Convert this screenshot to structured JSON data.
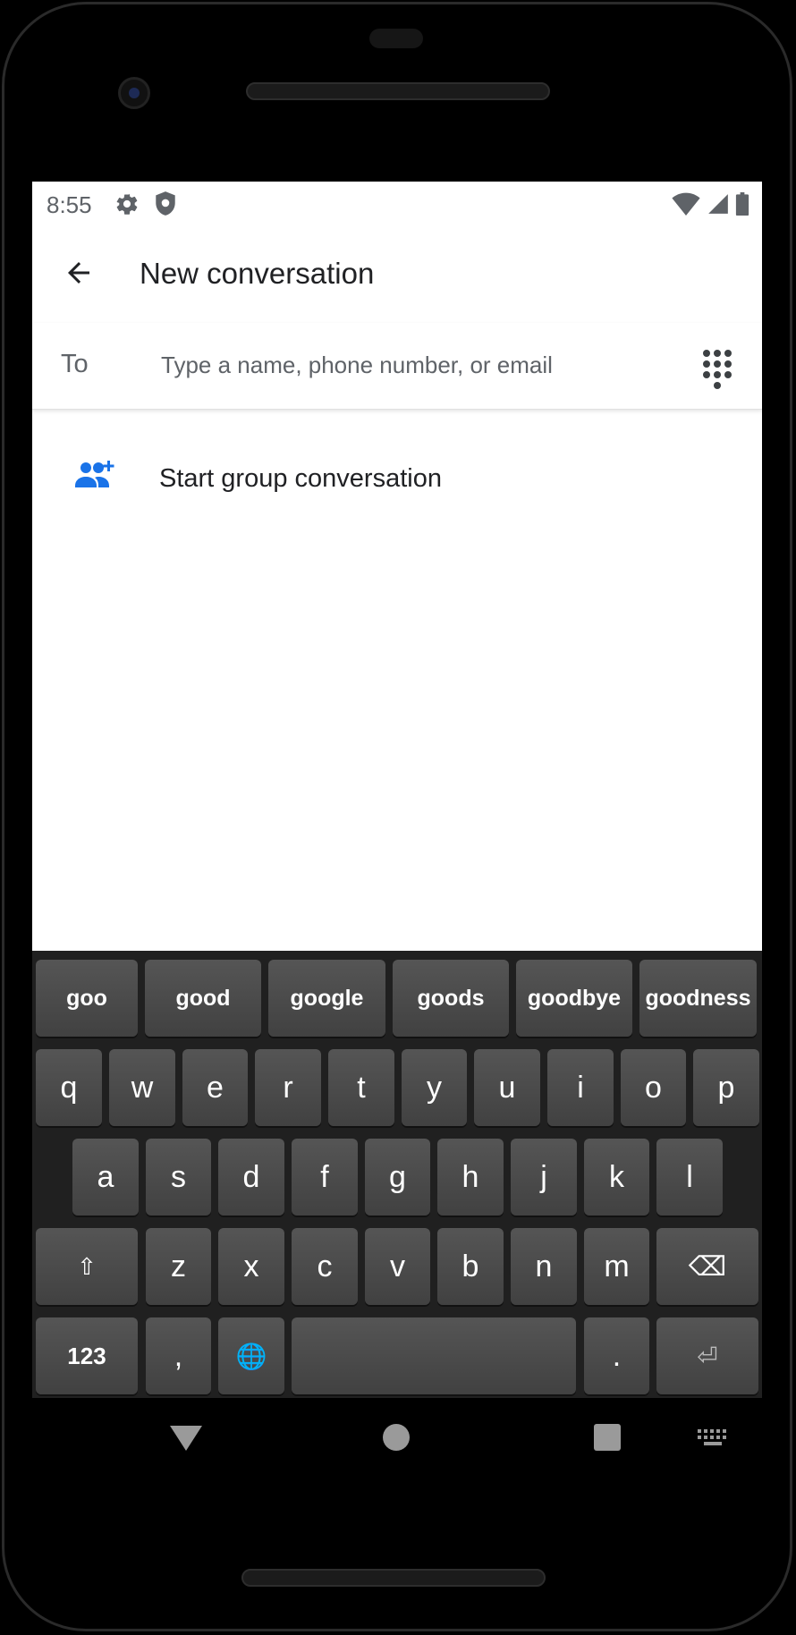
{
  "status": {
    "time": "8:55"
  },
  "appbar": {
    "title": "New conversation"
  },
  "recipient": {
    "label": "To",
    "placeholder": "Type a name, phone number, or email"
  },
  "group": {
    "label": "Start group conversation"
  },
  "keyboard": {
    "suggestions": [
      "goo",
      "good",
      "google",
      "goods",
      "goodbye",
      "goodness"
    ],
    "row1": [
      "q",
      "w",
      "e",
      "r",
      "t",
      "y",
      "u",
      "i",
      "o",
      "p"
    ],
    "row2": [
      "a",
      "s",
      "d",
      "f",
      "g",
      "h",
      "j",
      "k",
      "l"
    ],
    "row3": [
      "z",
      "x",
      "c",
      "v",
      "b",
      "n",
      "m"
    ],
    "shift": "⇧",
    "backspace": "⌫",
    "symbols": "123",
    "comma": ",",
    "globe": "🌐",
    "period": ".",
    "enter": "⏎"
  },
  "colors": {
    "accent": "#1a73e8",
    "keyboard_bg": "#202020",
    "key": "#4a4a4a"
  }
}
